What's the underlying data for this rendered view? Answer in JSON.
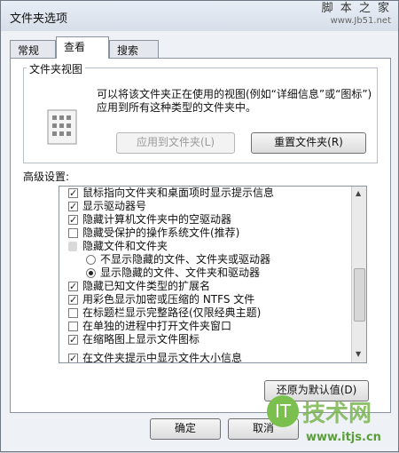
{
  "window": {
    "title": "文件夹选项"
  },
  "watermark": {
    "top_text": "脚 本 之 家",
    "top_url": "www.Jb51.net",
    "logo_text": "技术网",
    "logo_url": "www.itjs.cn",
    "logo_mark": "IT"
  },
  "tabs": [
    {
      "label": "常规",
      "active": false
    },
    {
      "label": "查看",
      "active": true
    },
    {
      "label": "搜索",
      "active": false
    }
  ],
  "folder_views": {
    "group_title": "文件夹视图",
    "description": "可以将该文件夹正在使用的视图(例如“详细信息”或“图标”)应用到所有这种类型的文件夹中。",
    "apply_button": "应用到文件夹(L)",
    "reset_button": "重置文件夹(R)"
  },
  "advanced": {
    "label": "高级设置:",
    "items": [
      {
        "type": "checkbox",
        "checked": true,
        "label": "鼠标指向文件夹和桌面项时显示提示信息"
      },
      {
        "type": "checkbox",
        "checked": true,
        "label": "显示驱动器号"
      },
      {
        "type": "checkbox",
        "checked": true,
        "label": "隐藏计算机文件夹中的空驱动器"
      },
      {
        "type": "checkbox",
        "checked": false,
        "label": "隐藏受保护的操作系统文件(推荐)"
      },
      {
        "type": "folder",
        "label": "隐藏文件和文件夹"
      },
      {
        "type": "radio",
        "checked": false,
        "label": "不显示隐藏的文件、文件夹或驱动器"
      },
      {
        "type": "radio",
        "checked": true,
        "label": "显示隐藏的文件、文件夹和驱动器"
      },
      {
        "type": "checkbox",
        "checked": true,
        "label": "隐藏已知文件类型的扩展名"
      },
      {
        "type": "checkbox",
        "checked": true,
        "label": "用彩色显示加密或压缩的 NTFS 文件"
      },
      {
        "type": "checkbox",
        "checked": false,
        "label": "在标题栏显示完整路径(仅限经典主题)"
      },
      {
        "type": "checkbox",
        "checked": false,
        "label": "在单独的进程中打开文件夹窗口"
      },
      {
        "type": "checkbox",
        "checked": true,
        "label": "在缩略图上显示文件图标"
      },
      {
        "type": "checkbox",
        "checked": true,
        "label": "在文件夹提示中显示文件大小信息"
      }
    ],
    "restore_button": "还原为默认值(D)"
  },
  "footer": {
    "ok_button": "确定",
    "cancel_button": "取消"
  }
}
